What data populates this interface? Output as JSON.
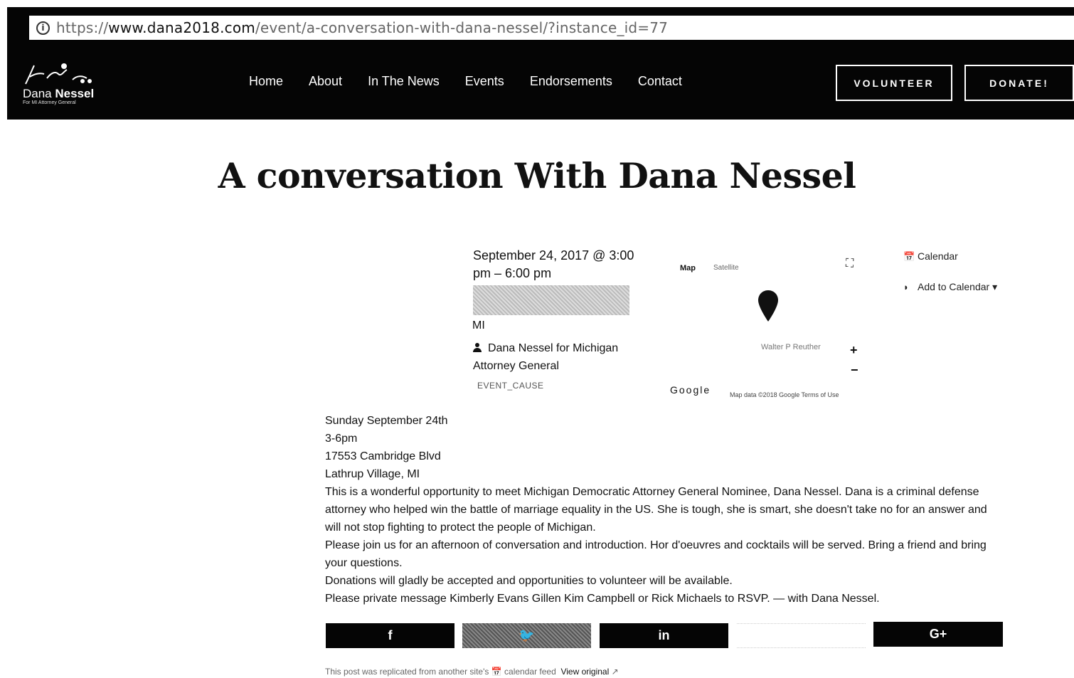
{
  "browser": {
    "url_scheme": "https://",
    "url_host": "www.dana2018.com",
    "url_path": "/event/a-conversation-with-dana-nessel/?instance_id=77"
  },
  "header": {
    "logo_first": "Dana",
    "logo_last": "Nessel",
    "logo_sub": "For MI Attorney General",
    "nav": [
      "Home",
      "About",
      "In The News",
      "Events",
      "Endorsements",
      "Contact"
    ],
    "volunteer": "VOLUNTEER",
    "donate": "DONATE!"
  },
  "event": {
    "title": "A conversation With Dana Nessel",
    "datetime": "September 24, 2017 @ 3:00 pm – 6:00 pm",
    "state": "MI",
    "organizer": "Dana Nessel for Michigan Attorney General",
    "cause": "EVENT_CAUSE"
  },
  "map": {
    "map_tab": "Map",
    "satellite_tab": "Satellite",
    "street": "Walter P Reuther",
    "google": "Google",
    "attribution": "Map data ©2018 Google Terms of Use"
  },
  "sidebar": {
    "calendar": "Calendar",
    "add_to_calendar": "Add to Calendar"
  },
  "description": [
    "Sunday September 24th",
    "3-6pm",
    "17553 Cambridge Blvd",
    "Lathrup Village, MI",
    "This is a wonderful opportunity to meet Michigan Democratic Attorney General Nominee, Dana Nessel. Dana is a criminal defense attorney who helped win the battle of marriage equality in the US. She is tough, she is smart, she doesn't take no for an answer and will not stop fighting to protect the people of Michigan.",
    "Please join us for an afternoon of conversation and introduction. Hor d'oeuvres and cocktails will be served. Bring a friend and bring your questions.",
    "Donations will gladly be accepted and opportunities to volunteer will be available.",
    "Please private message Kimberly Evans Gillen Kim Campbell or Rick Michaels to RSVP. — with Dana Nessel."
  ],
  "share": {
    "facebook": "f",
    "twitter": "t",
    "linkedin": "in",
    "googleplus": "G+"
  },
  "footnote": {
    "text": "This post was replicated from another site's",
    "feed": "calendar feed",
    "view_original": "View original"
  }
}
